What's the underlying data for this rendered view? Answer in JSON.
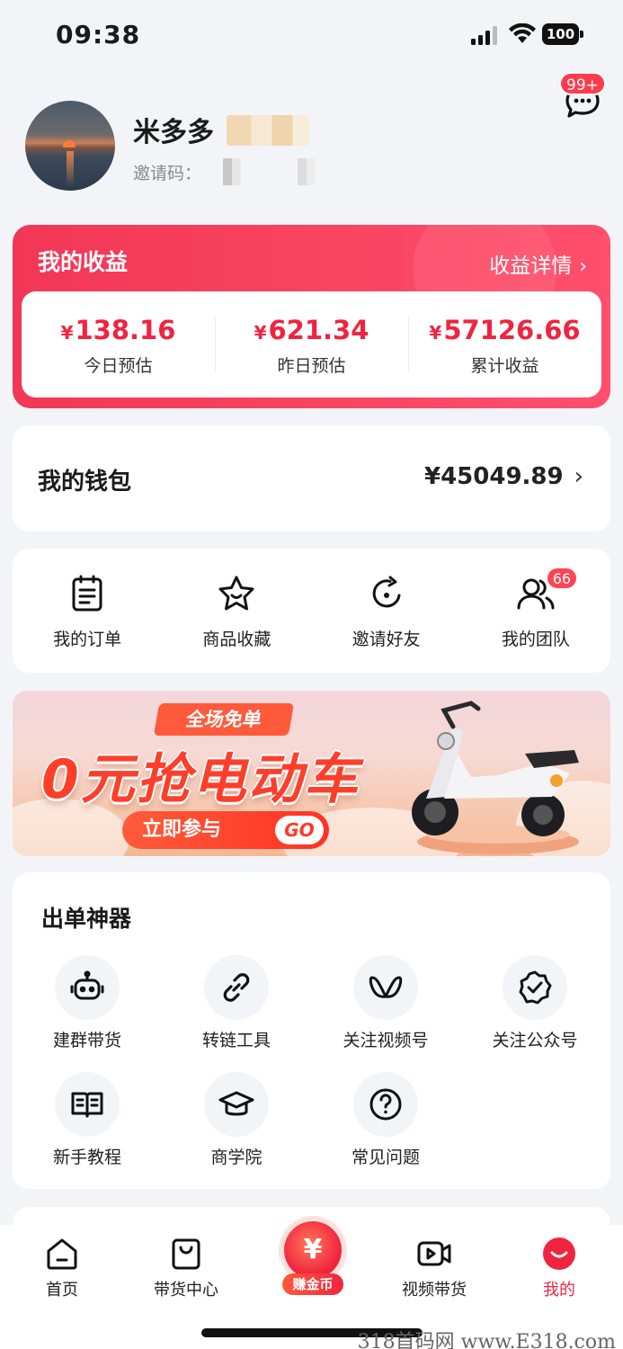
{
  "status_bar": {
    "time": "09:38",
    "battery": "100"
  },
  "profile": {
    "name": "米多多",
    "invite_label": "邀请码：",
    "message_badge": "99+"
  },
  "earnings": {
    "title": "我的收益",
    "detail_link": "收益详情",
    "stats": [
      {
        "value": "138.16",
        "label": "今日预估"
      },
      {
        "value": "621.34",
        "label": "昨日预估"
      },
      {
        "value": "57126.66",
        "label": "累计收益"
      }
    ],
    "currency": "¥"
  },
  "wallet": {
    "title": "我的钱包",
    "amount": "¥45049.89"
  },
  "quick_menu": [
    {
      "label": "我的订单",
      "icon": "clipboard-icon"
    },
    {
      "label": "商品收藏",
      "icon": "star-icon"
    },
    {
      "label": "邀请好友",
      "icon": "share-refresh-icon"
    },
    {
      "label": "我的团队",
      "icon": "team-icon",
      "badge": "66"
    }
  ],
  "banner": {
    "ribbon": "全场免单",
    "headline": "0元抢电动车",
    "cta": "立即参与",
    "go": "GO"
  },
  "tools": {
    "title": "出单神器",
    "items": [
      {
        "label": "建群带货",
        "icon": "robot-icon"
      },
      {
        "label": "转链工具",
        "icon": "link-icon"
      },
      {
        "label": "关注视频号",
        "icon": "video-channel-icon"
      },
      {
        "label": "关注公众号",
        "icon": "verified-badge-icon"
      },
      {
        "label": "新手教程",
        "icon": "book-icon"
      },
      {
        "label": "商学院",
        "icon": "graduation-cap-icon"
      },
      {
        "label": "常见问题",
        "icon": "question-icon"
      }
    ]
  },
  "tab_bar": [
    {
      "label": "首页",
      "icon": "home-icon"
    },
    {
      "label": "带货中心",
      "icon": "shopping-bag-icon"
    },
    {
      "label": "赚金币",
      "icon": "gold-coin-icon",
      "coin_symbol": "¥"
    },
    {
      "label": "视频带货",
      "icon": "video-icon"
    },
    {
      "label": "我的",
      "icon": "profile-smile-icon",
      "active": true
    }
  ],
  "watermark": "318首码网 www.E318.com",
  "colors": {
    "accent": "#f0243f",
    "background": "#f3f4f8"
  }
}
